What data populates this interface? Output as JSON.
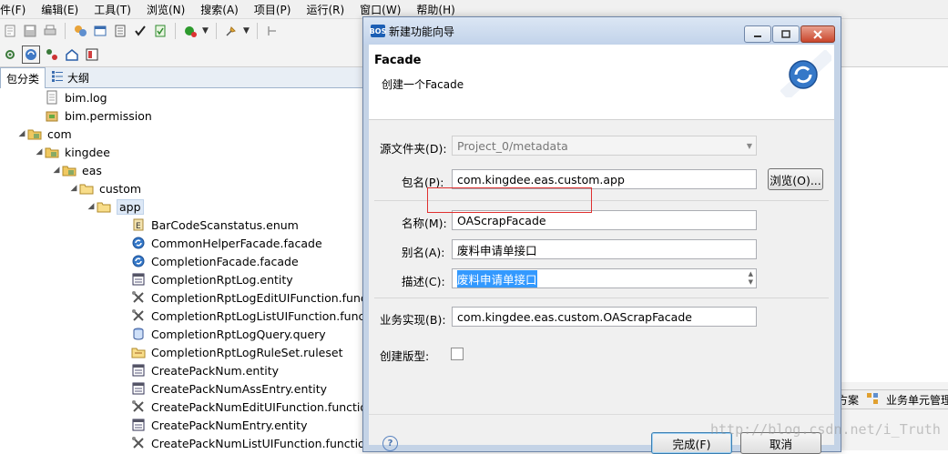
{
  "menu": [
    "件(F)",
    "编辑(E)",
    "工具(T)",
    "浏览(N)",
    "搜索(A)",
    "项目(P)",
    "运行(R)",
    "窗口(W)",
    "帮助(H)"
  ],
  "view_tabs": {
    "package": "包分类",
    "outline": "大纲"
  },
  "tree": [
    {
      "label": "bim.log",
      "indent": 3,
      "icon": "file-icon"
    },
    {
      "label": "bim.permission",
      "indent": 3,
      "icon": "package-icon"
    },
    {
      "label": "com",
      "indent": 2,
      "icon": "package-folder-icon",
      "expanded": true
    },
    {
      "label": "kingdee",
      "indent": 3,
      "icon": "package-folder-icon",
      "expanded": true
    },
    {
      "label": "eas",
      "indent": 4,
      "icon": "package-folder-icon",
      "expanded": true
    },
    {
      "label": "custom",
      "indent": 5,
      "icon": "folder-icon",
      "expanded": true
    },
    {
      "label": "app",
      "indent": 6,
      "icon": "folder-icon",
      "expanded": true,
      "selected": true
    },
    {
      "label": "BarCodeScanstatus.enum",
      "indent": 8,
      "icon": "enum-icon"
    },
    {
      "label": "CommonHelperFacade.facade",
      "indent": 8,
      "icon": "facade-icon"
    },
    {
      "label": "CompletionFacade.facade",
      "indent": 8,
      "icon": "facade-icon"
    },
    {
      "label": "CompletionRptLog.entity",
      "indent": 8,
      "icon": "entity-icon"
    },
    {
      "label": "CompletionRptLogEditUIFunction.function",
      "indent": 8,
      "icon": "function-icon"
    },
    {
      "label": "CompletionRptLogListUIFunction.function",
      "indent": 8,
      "icon": "function-icon"
    },
    {
      "label": "CompletionRptLogQuery.query",
      "indent": 8,
      "icon": "query-icon"
    },
    {
      "label": "CompletionRptLogRuleSet.ruleset",
      "indent": 8,
      "icon": "ruleset-icon"
    },
    {
      "label": "CreatePackNum.entity",
      "indent": 8,
      "icon": "entity-icon"
    },
    {
      "label": "CreatePackNumAssEntry.entity",
      "indent": 8,
      "icon": "entity-icon"
    },
    {
      "label": "CreatePackNumEditUIFunction.function",
      "indent": 8,
      "icon": "function-icon"
    },
    {
      "label": "CreatePackNumEntry.entity",
      "indent": 8,
      "icon": "entity-icon"
    },
    {
      "label": "CreatePackNumListUIFunction.function",
      "indent": 8,
      "icon": "function-icon"
    }
  ],
  "right_tabs": {
    "tab1": "方案",
    "tab2": "业务单元管理"
  },
  "dialog": {
    "app_badge": "BOS",
    "title": "新建功能向导",
    "banner_title": "Facade",
    "banner_desc": "创建一个Facade",
    "source_folder_label": "源文件夹(D):",
    "source_folder_value": "Project_0/metadata",
    "package_label": "包名(P):",
    "package_value": "com.kingdee.eas.custom.app",
    "browse_label": "浏览(O)...",
    "name_label": "名称(M):",
    "name_value": "OAScrapFacade",
    "alias_label": "别名(A):",
    "alias_value": "废料申请单接口",
    "desc_label": "描述(C):",
    "desc_value": "废料申请单接口",
    "impl_label": "业务实现(B):",
    "impl_value": "com.kingdee.eas.custom.OAScrapFacade",
    "create_version_label": "创建版型:",
    "create_version_checked": false,
    "finish_label": "完成(F)",
    "cancel_label": "取消"
  },
  "watermark": "http://blog.csdn.net/i_Truth"
}
